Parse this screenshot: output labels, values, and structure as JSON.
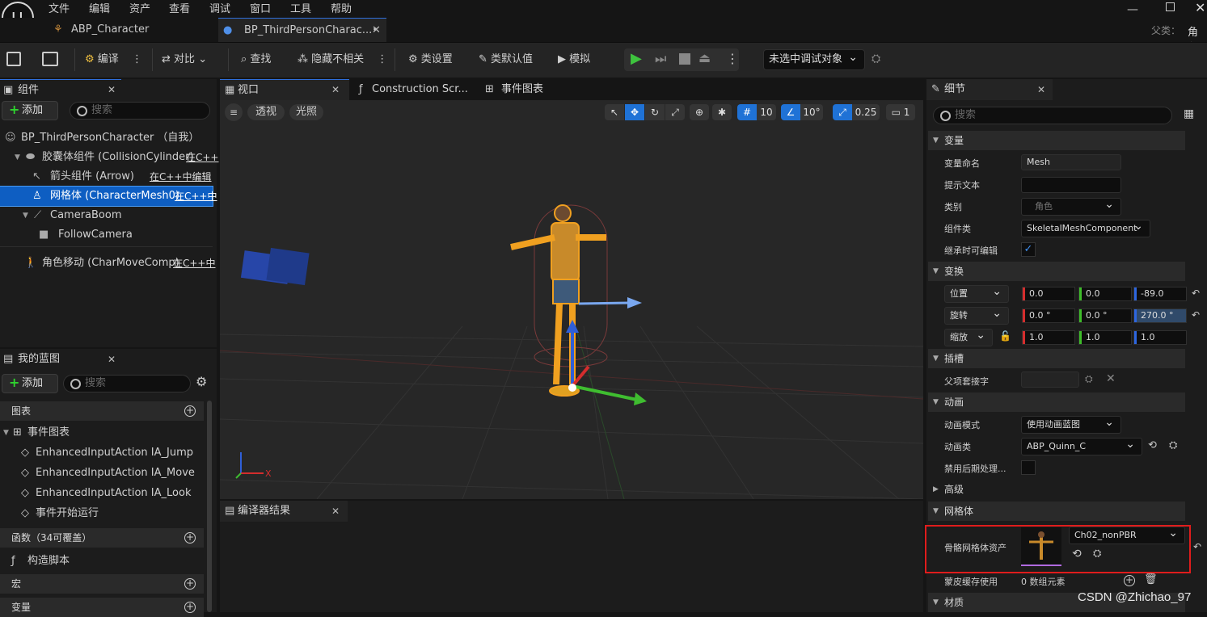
{
  "menu": [
    "文件",
    "编辑",
    "资产",
    "查看",
    "调试",
    "窗口",
    "工具",
    "帮助"
  ],
  "tabs": [
    {
      "label": "ABP_Character"
    },
    {
      "label": "BP_ThirdPersonCharac...•"
    }
  ],
  "parent": {
    "label": "父类：",
    "value": "角色"
  },
  "toolbar": {
    "compile": "编译",
    "diff": "对比",
    "find": "查找",
    "hide_unrelated": "隐藏不相关",
    "class_settings": "类设置",
    "class_defaults": "类默认值",
    "simulate": "模拟",
    "debug_target": "未选中调试对象"
  },
  "components": {
    "tab": "组件",
    "add": "添加",
    "search_placeholder": "搜索",
    "items": [
      {
        "name": "BP_ThirdPersonCharacter （自我）",
        "edit": ""
      },
      {
        "name": "胶囊体组件 (CollisionCylinder)",
        "edit": "在C++"
      },
      {
        "name": "箭头组件 (Arrow)",
        "edit": "在C++中编辑"
      },
      {
        "name": "网格体 (CharacterMesh0)",
        "edit": "在C++中"
      },
      {
        "name": "CameraBoom",
        "edit": ""
      },
      {
        "name": "FollowCamera",
        "edit": ""
      },
      {
        "name": "角色移动 (CharMoveComp)",
        "edit": "在C++中"
      }
    ]
  },
  "mybp": {
    "tab": "我的蓝图",
    "add": "添加",
    "search_placeholder": "搜索",
    "graphs_label": "图表",
    "event_graph": "事件图表",
    "events": [
      "EnhancedInputAction IA_Jump",
      "EnhancedInputAction IA_Move",
      "EnhancedInputAction IA_Look",
      "事件开始运行"
    ],
    "functions_label": "函数（34可覆盖）",
    "construct": "构造脚本",
    "macros": "宏",
    "variables": "变量"
  },
  "viewport": {
    "tabs": [
      {
        "label": "视口"
      },
      {
        "label": "Construction Scr..."
      },
      {
        "label": "事件图表"
      }
    ],
    "perspective": "透视",
    "lit": "光照",
    "grid": "10",
    "angle": "10°",
    "scale": "0.25",
    "camera_speed": "1",
    "axis_x": "X"
  },
  "compiler": {
    "tab": "编译器结果"
  },
  "details": {
    "tab": "细节",
    "search_placeholder": "搜索",
    "sections": {
      "variable": "变量",
      "transform": "变换",
      "sockets": "插槽",
      "animation": "动画",
      "advanced": "高级",
      "mesh": "网格体",
      "materials": "材质"
    },
    "var_name_label": "变量命名",
    "var_name": "Mesh",
    "tooltip_label": "提示文本",
    "tooltip": "",
    "category_label": "类别",
    "category": "角色",
    "component_class_label": "组件类",
    "component_class": "SkeletalMeshComponent",
    "editable_label": "继承时可编辑",
    "location": {
      "label": "位置",
      "x": "0.0",
      "y": "0.0",
      "z": "-89.0"
    },
    "rotation": {
      "label": "旋转",
      "x": "0.0 °",
      "y": "0.0 °",
      "z": "270.0 °"
    },
    "scale": {
      "label": "缩放",
      "x": "1.0",
      "y": "1.0",
      "z": "1.0"
    },
    "parent_socket_label": "父项套接字",
    "anim_mode_label": "动画模式",
    "anim_mode": "使用动画蓝图",
    "anim_class_label": "动画类",
    "anim_class": "ABP_Quinn_C",
    "disable_post_label": "禁用后期处理...",
    "skeletal_mesh_label": "骨骼网格体资产",
    "skeletal_mesh": "Ch02_nonPBR",
    "skin_cache_label": "蒙皮缓存使用",
    "skin_cache": "0 数组元素"
  },
  "watermark": "CSDN @Zhichao_97"
}
